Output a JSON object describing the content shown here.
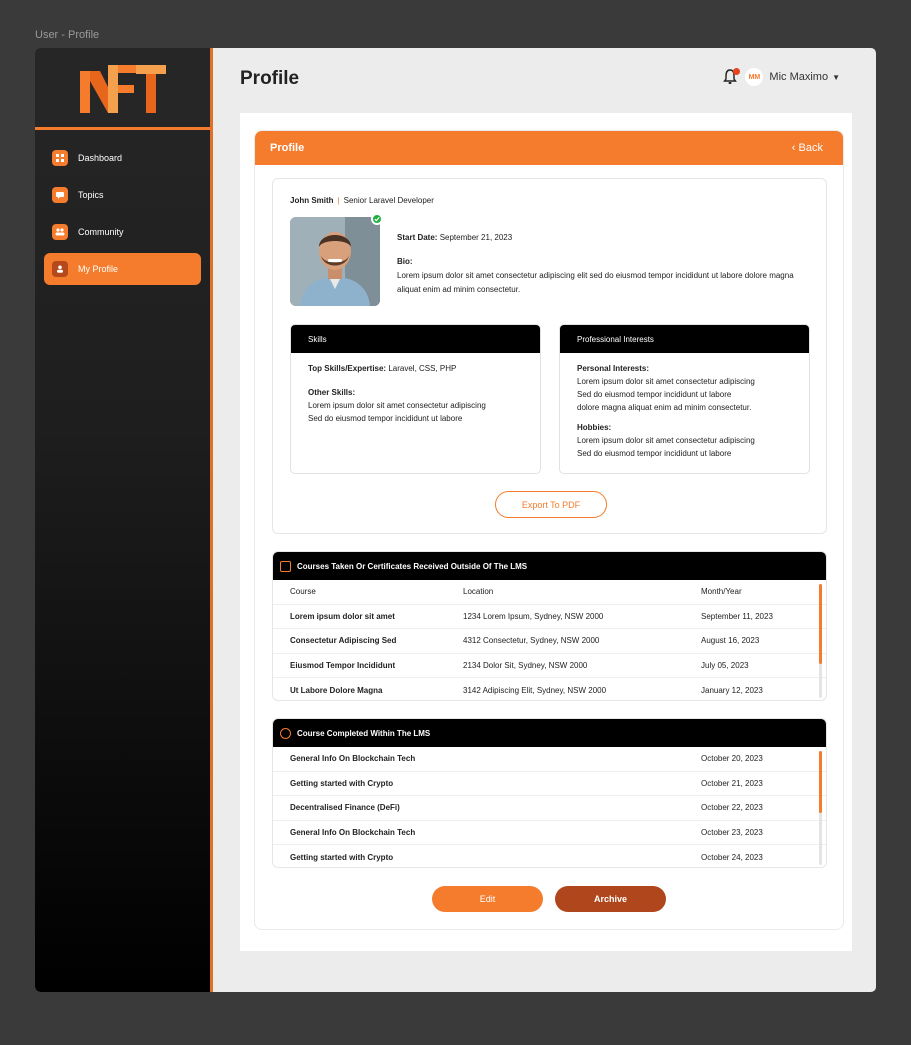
{
  "frame_label": "User - Profile",
  "sidebar": {
    "items": [
      {
        "label": "Dashboard",
        "icon": "grid-icon",
        "active": false
      },
      {
        "label": "Topics",
        "icon": "chat-icon",
        "active": false
      },
      {
        "label": "Community",
        "icon": "people-icon",
        "active": false
      },
      {
        "label": "My Profile",
        "icon": "user-icon",
        "active": true
      }
    ]
  },
  "header": {
    "title": "Profile",
    "notification_count": "1",
    "avatar_initials": "MM",
    "user_name": "Mic Maximo"
  },
  "panel": {
    "title": "Profile",
    "back_label": "Back"
  },
  "profile": {
    "name": "John Smith",
    "role": "Senior Laravel Developer",
    "start_date_label": "Start Date:",
    "start_date": "September 21, 2023",
    "bio_label": "Bio:",
    "bio": "Lorem ipsum dolor sit amet consectetur adipiscing elit sed do eiusmod tempor incididunt ut labore dolore magna aliquat enim ad minim consectetur."
  },
  "skills": {
    "title": "Skills",
    "top_label": "Top Skills/Expertise:",
    "top_value": "Laravel, CSS, PHP",
    "other_label": "Other Skills:",
    "other_line1": "Lorem ipsum dolor sit amet consectetur adipiscing",
    "other_line2": "Sed do eiusmod tempor incididunt ut labore"
  },
  "interests": {
    "title": "Professional Interests",
    "personal_label": "Personal Interests:",
    "personal_line1": "Lorem ipsum dolor sit amet consectetur adipiscing",
    "personal_line2": "Sed do eiusmod tempor incididunt ut labore",
    "personal_line3": "dolore magna aliquat enim ad minim consectetur.",
    "hobbies_label": "Hobbies:",
    "hobbies_line1": "Lorem ipsum dolor sit amet consectetur adipiscing",
    "hobbies_line2": "Sed do eiusmod tempor incididunt ut labore"
  },
  "export_label": "Export To PDF",
  "external_courses": {
    "title": "Courses Taken Or Certificates Received Outside Of The LMS",
    "columns": [
      "Course",
      "Location",
      "Month/Year"
    ],
    "rows": [
      [
        "Lorem ipsum dolor sit amet",
        "1234 Lorem Ipsum, Sydney, NSW 2000",
        "September 11, 2023"
      ],
      [
        "Consectetur Adipiscing Sed",
        "4312 Consectetur, Sydney, NSW 2000",
        "August 16, 2023"
      ],
      [
        "Eiusmod Tempor Incididunt",
        "2134 Dolor Sit, Sydney, NSW 2000",
        "July 05, 2023"
      ],
      [
        "Ut Labore Dolore Magna",
        "3142 Adipiscing Elit, Sydney, NSW 2000",
        "January 12, 2023"
      ]
    ]
  },
  "lms_courses": {
    "title": "Course Completed Within The LMS",
    "rows": [
      [
        "General Info On Blockchain Tech",
        "October 20, 2023"
      ],
      [
        "Getting started with Crypto",
        "October 21, 2023"
      ],
      [
        "Decentralised Finance (DeFi)",
        "October 22, 2023"
      ],
      [
        "General Info On Blockchain Tech",
        "October 23, 2023"
      ],
      [
        "Getting started with Crypto",
        "October 24, 2023"
      ]
    ]
  },
  "actions": {
    "edit_label": "Edit",
    "archive_label": "Archive"
  },
  "colors": {
    "accent": "#f47c2c",
    "accent_dark": "#b0461b",
    "verified": "#1fae3f"
  }
}
